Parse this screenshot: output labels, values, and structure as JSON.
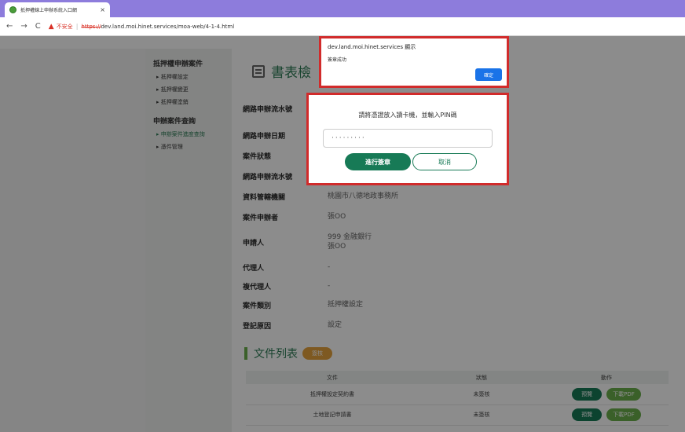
{
  "browser": {
    "tab_title": "抵押權線上申辦系統入口網",
    "tab_close": "×",
    "back": "←",
    "forward": "→",
    "reload": "C",
    "security_warning": "不安全",
    "security_sep": "|",
    "url_scheme": "https://",
    "url_rest": "dev.land.moi.hinet.services/moa-web/4-1-4.html"
  },
  "sidebar": {
    "group1": "抵押權申辦案件",
    "items1": [
      "▸ 抵押權設定",
      "▸ 抵押權變更",
      "▸ 抵押權塗銷"
    ],
    "group2": "申辦案件查詢",
    "items2": [
      "▸ 申辦案件進度查詢",
      "▸ 憑件管理"
    ]
  },
  "main": {
    "title": "書表檢"
  },
  "fields": [
    {
      "label": "網路申辦流水號",
      "value": ""
    },
    {
      "label": "網路申辦日期",
      "value": ""
    },
    {
      "label": "案件狀態",
      "value": ""
    },
    {
      "label": "網路申辦流水號",
      "value": ""
    },
    {
      "label": "資料管轄機關",
      "value": "桃園市八德地政事務所"
    },
    {
      "label": "案件申辦者",
      "value": "張OO"
    },
    {
      "label": "申請人",
      "value": "999 金融銀行\n張OO"
    },
    {
      "label": "代理人",
      "value": "-"
    },
    {
      "label": "複代理人",
      "value": "-"
    },
    {
      "label": "案件類別",
      "value": "抵押權設定"
    },
    {
      "label": "登記原因",
      "value": "設定"
    }
  ],
  "documents": {
    "title": "文件列表",
    "badge": "簽核",
    "headers": [
      "文件",
      "狀態",
      "動作"
    ],
    "rows": [
      {
        "name": "抵押權設定契約書",
        "status": "未簽核",
        "preview": "預覽",
        "download": "下載PDF"
      },
      {
        "name": "土地登記申請書",
        "status": "未簽核",
        "preview": "預覽",
        "download": "下載PDF"
      }
    ]
  },
  "alert": {
    "host": "dev.land.moi.hinet.services 顯示",
    "message": "簽章成功",
    "ok": "確定"
  },
  "pin_dialog": {
    "prompt": "請將憑證放入讀卡機，並輸入PIN碼",
    "pin_value": "·········",
    "sign_button": "進行簽章",
    "cancel_button": "取消"
  }
}
